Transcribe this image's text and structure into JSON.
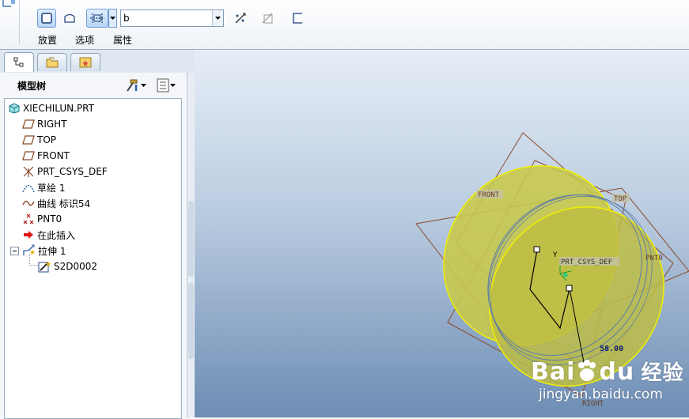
{
  "dashboard": {
    "combo_value": "b",
    "tabs": [
      "放置",
      "选项",
      "属性"
    ]
  },
  "model_tree": {
    "title": "模型树",
    "items": [
      {
        "label": "XIECHILUN.PRT"
      },
      {
        "label": "RIGHT"
      },
      {
        "label": "TOP"
      },
      {
        "label": "FRONT"
      },
      {
        "label": "PRT_CSYS_DEF"
      },
      {
        "label": "草绘 1"
      },
      {
        "label": "曲线 标识54"
      },
      {
        "label": "PNT0"
      },
      {
        "label": "在此插入"
      },
      {
        "label": "拉伸 1"
      },
      {
        "label": "S2D0002"
      }
    ]
  },
  "viewport": {
    "labels": {
      "front": "FRONT",
      "top": "TOP",
      "csys": "PRT_CSYS_DEF",
      "pnt": "PNT0",
      "right": "RIGHT",
      "y_axis": "Y",
      "dimension": "58.00"
    },
    "watermark": {
      "brand": "Bai",
      "brand2": "du",
      "product": "经验",
      "url": "jingyan.baidu.com"
    }
  },
  "colors": {
    "extrude_fill": "#c8c84a",
    "extrude_edge": "#f0f000",
    "datum_plane": "#8a4a2a",
    "sketch_line": "#000000",
    "gfx_top": "#e6eef7",
    "gfx_bottom": "#6d8db4"
  }
}
